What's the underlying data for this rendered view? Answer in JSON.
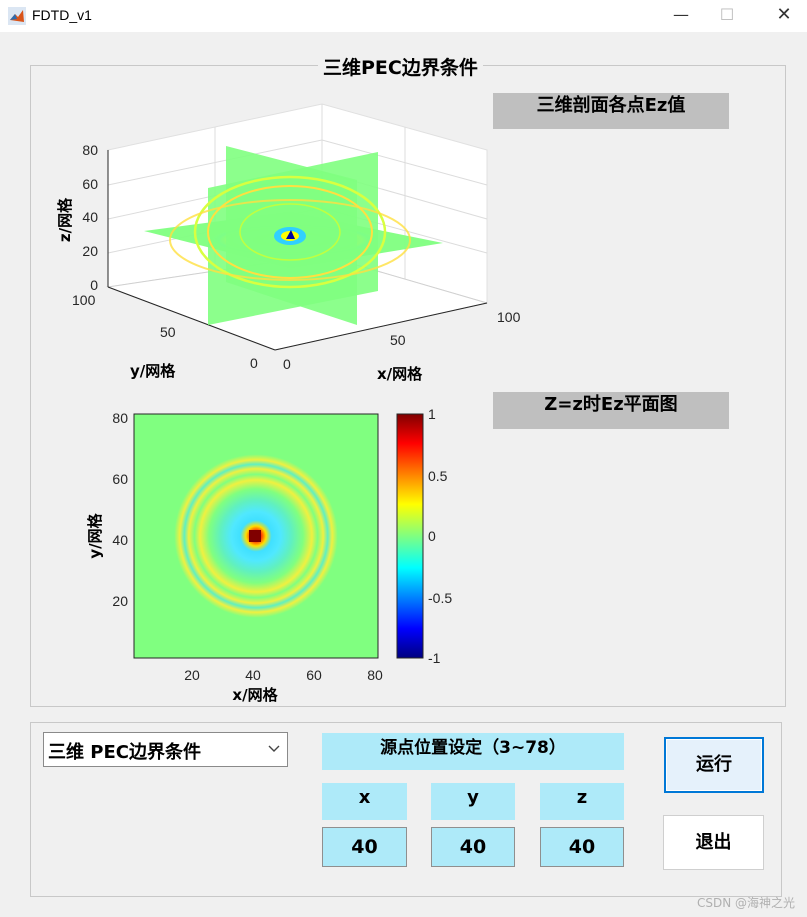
{
  "window": {
    "title": "FDTD_v1",
    "controls": {
      "minimize": "—",
      "maximize": "☐",
      "close": "✕"
    }
  },
  "panel": {
    "title": "三维PEC边界条件",
    "label_3d": "三维剖面各点Ez值",
    "label_2d": "Z=z时Ez平面图"
  },
  "chart_data": [
    {
      "type": "3d-slice",
      "zlabel": "z/网格",
      "ylabel": "y/网格",
      "xlabel": "x/网格",
      "z_ticks": [
        "80",
        "60",
        "40",
        "20",
        "0"
      ],
      "y_ticks": [
        "100",
        "50",
        "0"
      ],
      "x_ticks": [
        "0",
        "50",
        "100"
      ],
      "zlim": [
        0,
        80
      ],
      "xlim": [
        0,
        100
      ],
      "ylim": [
        0,
        100
      ],
      "slice_at": {
        "x": 40,
        "y": 40,
        "z": 40
      },
      "grid": true
    },
    {
      "type": "heatmap",
      "xlabel": "x/网格",
      "ylabel": "y/网格",
      "x_ticks": [
        "20",
        "40",
        "60",
        "80"
      ],
      "y_ticks": [
        "80",
        "60",
        "40",
        "20"
      ],
      "xlim": [
        1,
        80
      ],
      "ylim": [
        1,
        80
      ],
      "peak": {
        "x": 40,
        "y": 40,
        "value": 1
      },
      "colorbar": {
        "ticks": [
          "1",
          "0.5",
          "0",
          "-0.5",
          "-1"
        ],
        "range": [
          -1,
          1
        ],
        "colormap": "jet"
      }
    }
  ],
  "controls": {
    "mode_select": "三维  PEC边界条件",
    "source_title": "源点位置设定（3~78）",
    "x_label": "x",
    "y_label": "y",
    "z_label": "z",
    "x_value": "40",
    "y_value": "40",
    "z_value": "40",
    "run_button": "运行",
    "exit_button": "退出"
  },
  "watermark": "CSDN @海神之光",
  "colors": {
    "background": "#f0f0f0",
    "label_gray": "#bfbfbf",
    "field_cyan": "#aeeaf9",
    "heatmap_bg": "#80ff80"
  }
}
